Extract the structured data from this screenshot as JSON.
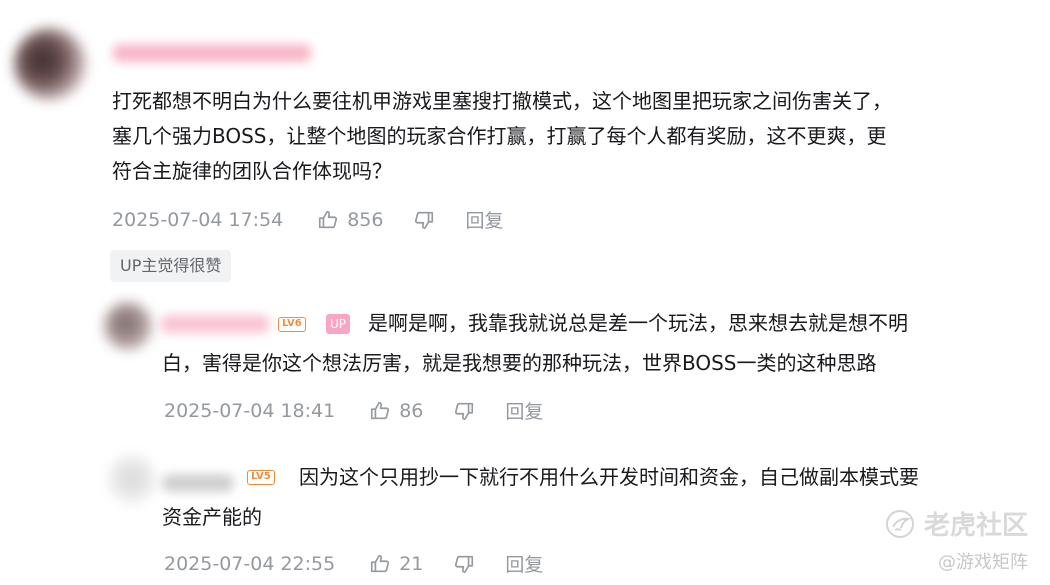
{
  "comment1": {
    "text_lines": [
      "打死都想不明白为什么要往机甲游戏里塞搜打撤模式，这个地图里把玩家之间伤害关了，",
      "塞几个强力BOSS，让整个地图的玩家合作打赢，打赢了每个人都有奖励，这不更爽，更",
      "符合主旋律的团队合作体现吗？"
    ],
    "time": "2025-07-04 17:54",
    "likes": "856",
    "reply_label": "回复",
    "tag": "UP主觉得很赞"
  },
  "reply1": {
    "level": "LV6",
    "up_badge": "UP",
    "text_lines": [
      "是啊是啊，我靠我就说总是差一个玩法，思来想去就是想不明",
      "白，害得是你这个想法厉害，就是我想要的那种玩法，世界BOSS一类的这种思路"
    ],
    "time": "2025-07-04 18:41",
    "likes": "86",
    "reply_label": "回复"
  },
  "reply2": {
    "level": "LV5",
    "text_lines": [
      "因为这个只用抄一下就行不用什么开发时间和资金，自己做副本模式要",
      "资金产能的"
    ],
    "time": "2025-07-04 22:55",
    "likes": "21",
    "reply_label": "回复"
  },
  "watermark": {
    "site": "老虎社区",
    "account": "@游戏矩阵"
  },
  "colors": {
    "text": "#18191c",
    "meta": "#9499a0",
    "level_badge": "#f28c3b",
    "up_badge": "#f9a5c3",
    "tag_bg": "#f1f2f3"
  }
}
